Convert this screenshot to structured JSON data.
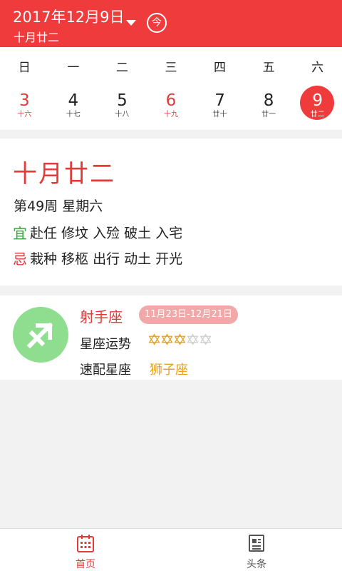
{
  "header": {
    "date": "2017年12月9日",
    "lunar": "十月廿二",
    "today_label": "今"
  },
  "calendar": {
    "weekdays": [
      "日",
      "一",
      "二",
      "三",
      "四",
      "五",
      "六"
    ],
    "days": [
      {
        "num": "3",
        "lunar": "十六"
      },
      {
        "num": "4",
        "lunar": "十七"
      },
      {
        "num": "5",
        "lunar": "十八"
      },
      {
        "num": "6",
        "lunar": "十九"
      },
      {
        "num": "7",
        "lunar": "廿十"
      },
      {
        "num": "8",
        "lunar": "廿一"
      },
      {
        "num": "9",
        "lunar": "廿二"
      }
    ]
  },
  "info": {
    "lunar_big": "十月廿二",
    "week": "第49周 星期六",
    "yi_tag": "宜",
    "yi": "赴任 修坟 入殓 破土 入宅",
    "ji_tag": "忌",
    "ji": "栽种 移柩 出行 动土 开光"
  },
  "zodiac": {
    "name": "射手座",
    "range": "11月23日-12月21日",
    "luck_label": "星座运势",
    "luck_stars": 3,
    "luck_max": 5,
    "match_label": "速配星座",
    "match": "狮子座"
  },
  "tabs": {
    "home": "首页",
    "news": "头条"
  },
  "colors": {
    "brand": "#ef3b3b",
    "emblem": "#8fdd8f",
    "star": "#e5a31b"
  }
}
